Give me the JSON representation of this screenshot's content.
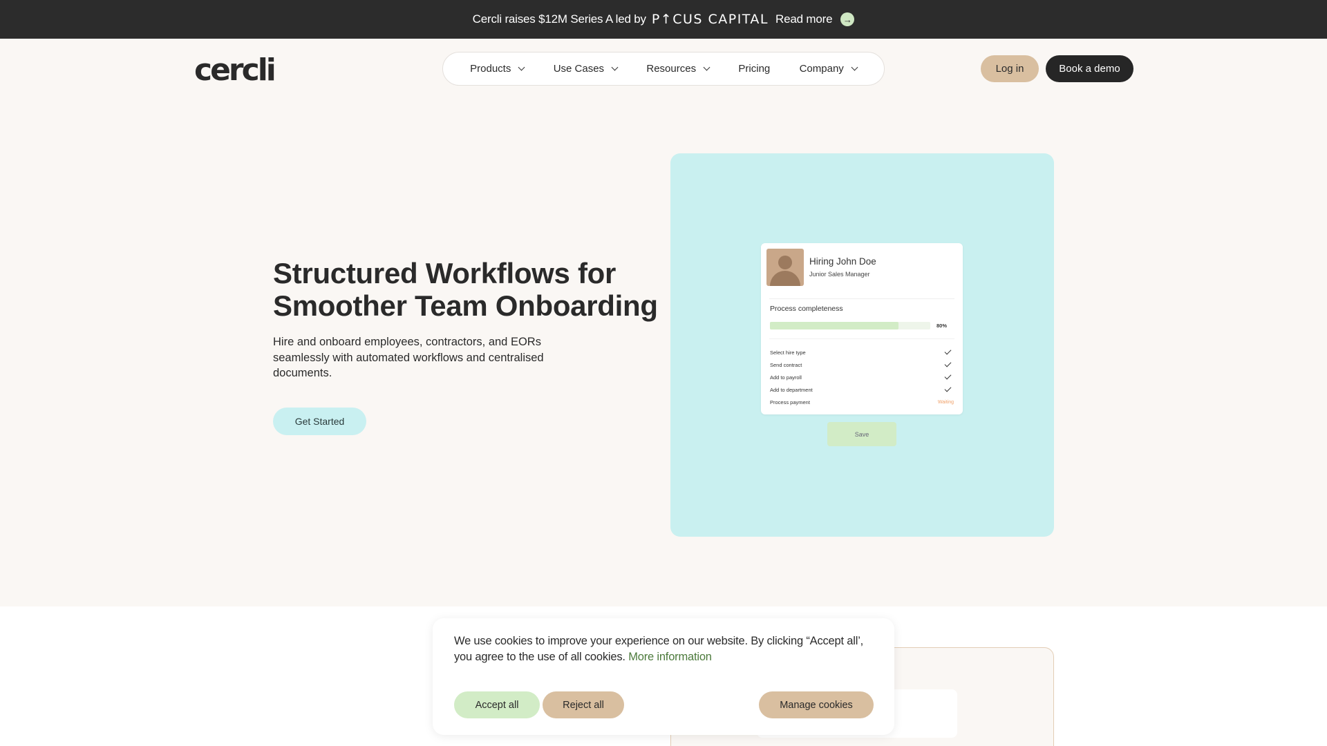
{
  "announcement": {
    "text": "Cercli raises $12M Series A led by",
    "brand": "P↑CUS CAPITAL",
    "link": "Read more",
    "arrow": "→"
  },
  "header": {
    "logo": "cercli",
    "nav": [
      {
        "label": "Products",
        "has_dropdown": true
      },
      {
        "label": "Use Cases",
        "has_dropdown": true
      },
      {
        "label": "Resources",
        "has_dropdown": true
      },
      {
        "label": "Pricing",
        "has_dropdown": false
      },
      {
        "label": "Company",
        "has_dropdown": true
      }
    ],
    "login": "Log in",
    "demo": "Book a demo"
  },
  "hero": {
    "title_line1": "Structured Workflows for",
    "title_line2": "Smoother Team Onboarding",
    "subtitle": "Hire and onboard employees, contractors, and EORs seamlessly with automated workflows and centralised documents.",
    "cta": "Get Started"
  },
  "card": {
    "name": "Hiring John Doe",
    "role": "Junior Sales Manager",
    "process_label": "Process completeness",
    "progress": 0.8,
    "progress_label": "80%",
    "steps": [
      {
        "label": "Select hire type",
        "status": "done"
      },
      {
        "label": "Send contract",
        "status": "done"
      },
      {
        "label": "Add to payroll",
        "status": "done"
      },
      {
        "label": "Add to department",
        "status": "done"
      },
      {
        "label": "Process payment",
        "status": "Waiting"
      }
    ],
    "save": "Save"
  },
  "cookie": {
    "text": "We use cookies to improve your experience on our website. By clicking “Accept all’, you agree to the use of all cookies.",
    "more": "More information",
    "accept": "Accept all",
    "reject": "Reject all",
    "manage": "Manage cookies"
  },
  "colors": {
    "accent_green": "#d2ecc6",
    "accent_tan": "#d9bfa0",
    "accent_cyan": "#c9f0f0",
    "dark": "#262626"
  }
}
